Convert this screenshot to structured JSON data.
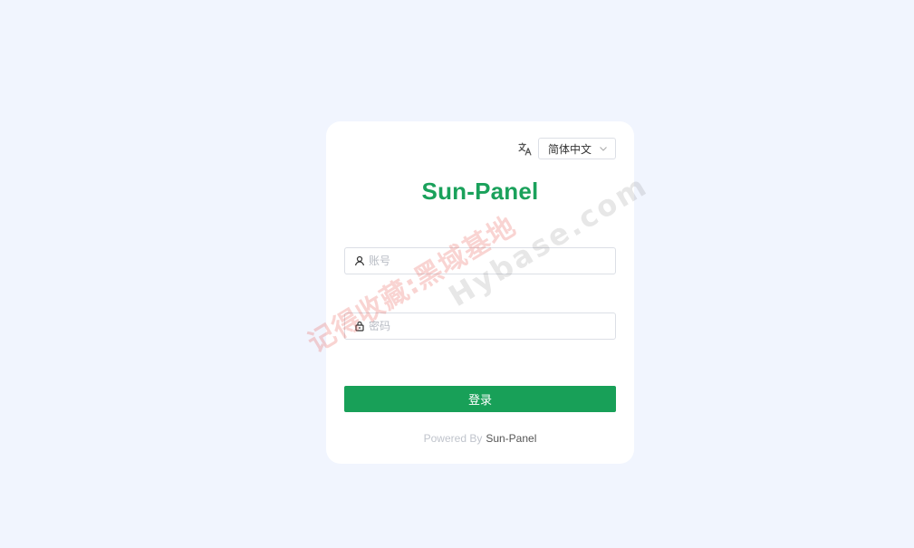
{
  "language": {
    "selected": "简体中文",
    "icon": "translate-icon"
  },
  "brand": {
    "title": "Sun-Panel",
    "color": "#1aa15b"
  },
  "form": {
    "username_placeholder": "账号",
    "username_icon": "user-icon",
    "password_placeholder": "密码",
    "password_icon": "lock-icon",
    "login_label": "登录",
    "accent_color": "#18a058"
  },
  "footer": {
    "powered_label": "Powered By",
    "powered_link": "Sun-Panel"
  },
  "watermark": {
    "line1": "记得收藏:黑域基地",
    "line2": "Hybase.com"
  }
}
